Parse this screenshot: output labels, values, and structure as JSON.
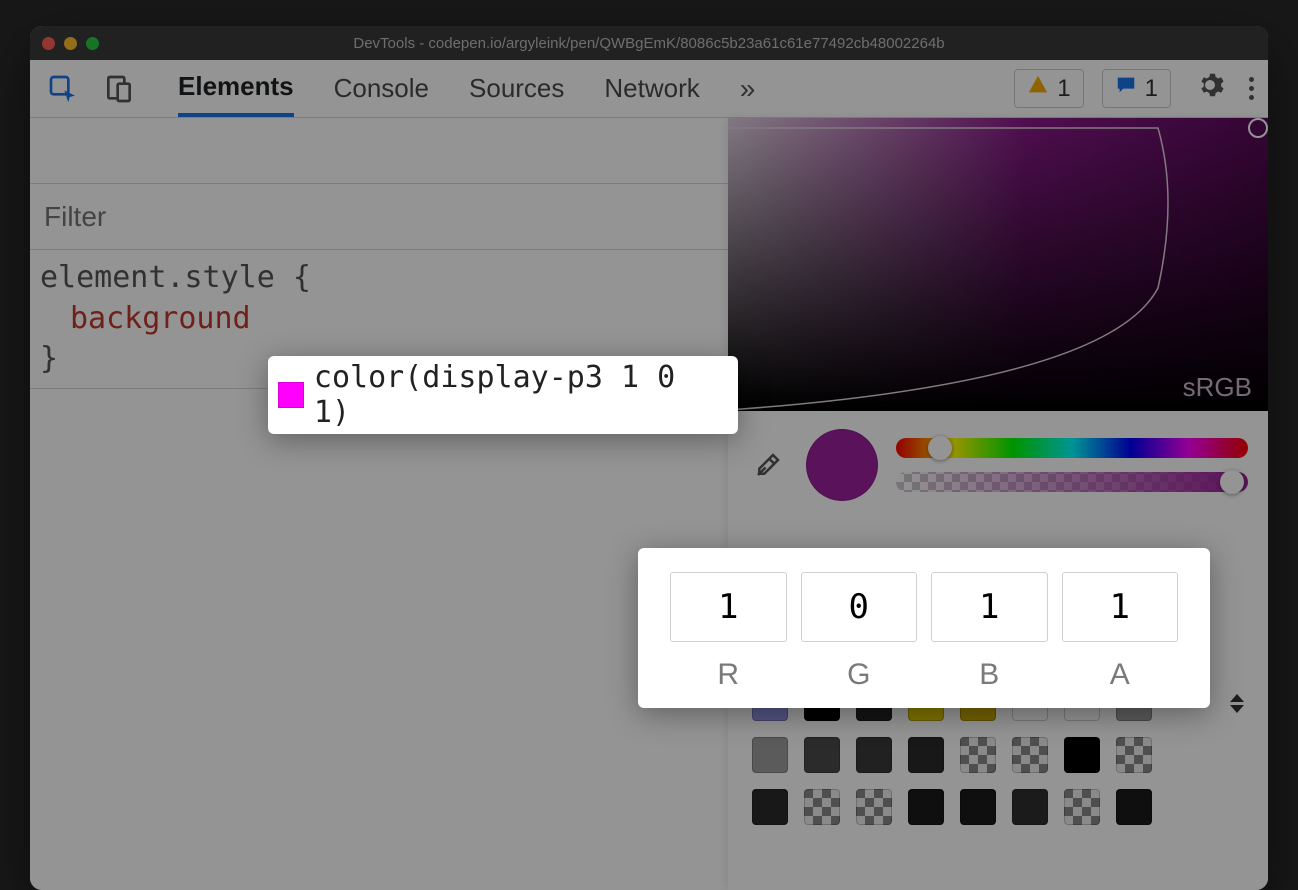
{
  "window": {
    "title": "DevTools - codepen.io/argyleink/pen/QWBgEmK/8086c5b23a61c61e77492cb48002264b"
  },
  "toolbar": {
    "tabs": [
      "Elements",
      "Console",
      "Sources",
      "Network"
    ],
    "active_tab_index": 0,
    "warning_count": "1",
    "issues_count": "1"
  },
  "styles": {
    "filter_placeholder": "Filter",
    "selector": "element.style {",
    "property_name": "background",
    "close_brace": "}"
  },
  "popover": {
    "color_func": "color(display-p3 1 0 1)",
    "swatch_hex": "#ff00ff"
  },
  "picker": {
    "gamut_label": "sRGB",
    "current_hex": "#9b1f9b",
    "channels": [
      {
        "label": "R",
        "value": "1"
      },
      {
        "label": "G",
        "value": "0"
      },
      {
        "label": "B",
        "value": "1"
      },
      {
        "label": "A",
        "value": "1"
      }
    ],
    "palette_rows": [
      [
        "#8f8fe0",
        "#000000",
        "#222222",
        "#d9c400",
        "#c8aa00",
        "#ffffff",
        "#ffffff",
        "#9e9e9e"
      ],
      [
        "#9e9e9e",
        "#4a4a4a",
        "#3a3a3a",
        "#2a2a2a",
        "checker",
        "checker",
        "#000000",
        "checker"
      ],
      [
        "#2a2a2a",
        "checker",
        "checker",
        "#1a1a1a",
        "#1a1a1a",
        "#303030",
        "checker",
        "#1a1a1a"
      ]
    ]
  }
}
